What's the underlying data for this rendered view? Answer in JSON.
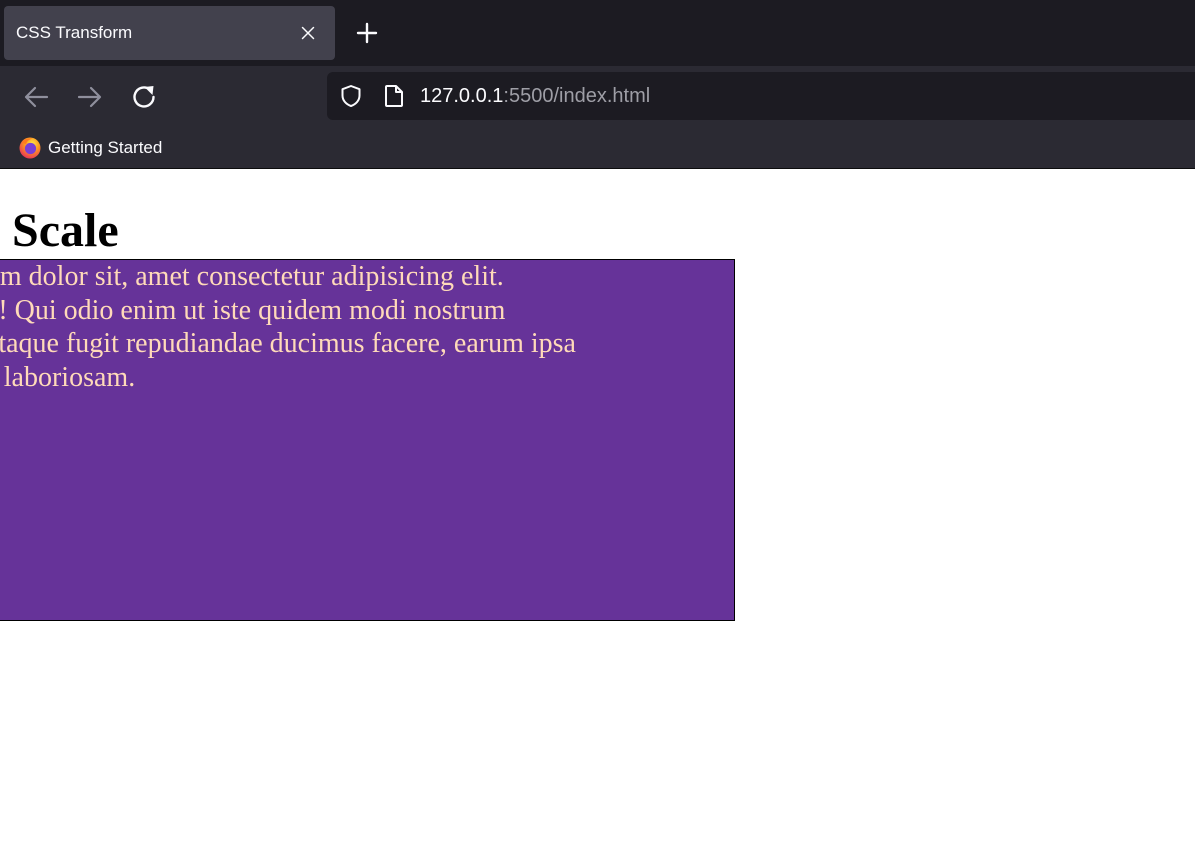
{
  "browser": {
    "tab": {
      "title": "CSS Transform"
    },
    "url": {
      "host": "127.0.0.1",
      "rest": ":5500/index.html"
    },
    "bookmarks": [
      {
        "label": "Getting Started"
      }
    ],
    "icons": {
      "close": "close-icon",
      "new_tab": "plus-icon",
      "back": "arrow-left-icon",
      "forward": "arrow-right-icon",
      "reload": "reload-icon",
      "shield": "shield-icon",
      "page": "page-icon",
      "firefox": "firefox-icon"
    }
  },
  "page": {
    "heading": "Scale",
    "box": {
      "lines": [
        "psum dolor sit, amet consectetur adipisicing elit.",
        "eos! Qui odio enim ut iste quidem modi nostrum",
        "it, itaque fugit repudiandae ducimus facere, earum ipsa",
        "um laboriosam."
      ],
      "background": "#663399",
      "text_color": "#ffdab9"
    }
  }
}
